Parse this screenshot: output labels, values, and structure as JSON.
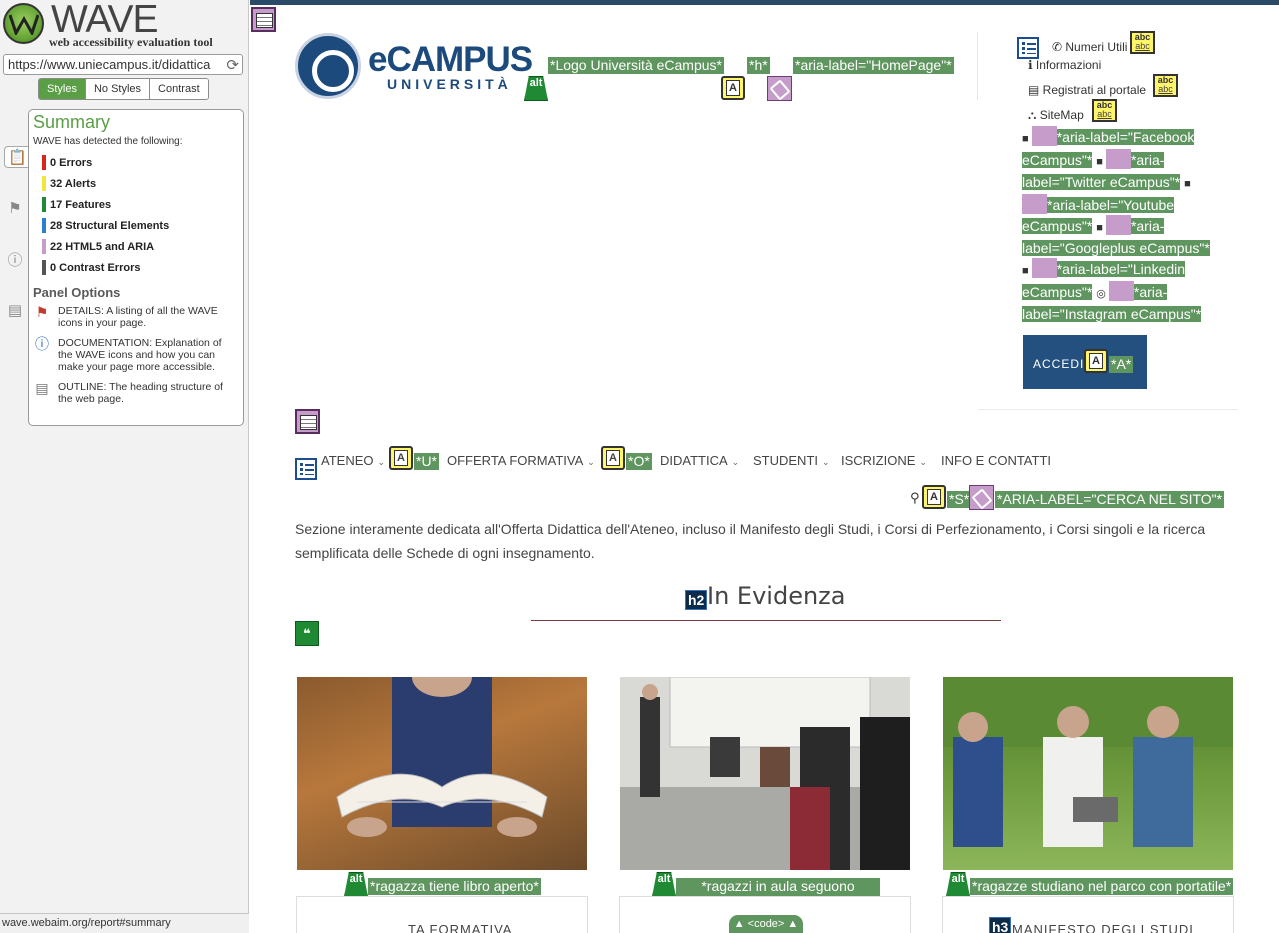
{
  "wave": {
    "logo_text": "WAVE",
    "subtitle": "web accessibility evaluation tool",
    "url": "https://www.uniecampus.it/didattica",
    "tabs": [
      "Styles",
      "No Styles",
      "Contrast"
    ],
    "summary_title": "Summary",
    "detected_text": "WAVE has detected the following:",
    "counts": [
      {
        "label": "0 Errors",
        "color": "#d9261c"
      },
      {
        "label": "32 Alerts",
        "color": "#f0e63c"
      },
      {
        "label": "17 Features",
        "color": "#1f8a33"
      },
      {
        "label": "28 Structural Elements",
        "color": "#2a7fd4"
      },
      {
        "label": "22 HTML5 and ARIA",
        "color": "#c69ccb"
      },
      {
        "label": "0 Contrast Errors",
        "color": "#555555"
      }
    ],
    "panel_options_title": "Panel Options",
    "options": [
      {
        "icon": "flag-icon",
        "text": "DETAILS: A listing of all the WAVE icons in your page."
      },
      {
        "icon": "info-icon",
        "text": "DOCUMENTATION: Explanation of the WAVE icons and how you can make your page more accessible."
      },
      {
        "icon": "outline-icon",
        "text": "OUTLINE: The heading structure of the web page."
      }
    ],
    "status_url": "wave.webaim.org/report#summary"
  },
  "page": {
    "logo_word": "eCAMPUS",
    "logo_sub": "UNIVERSITÀ",
    "labels": {
      "logo_alt": "*Logo Università eCampus*",
      "h_label": "*h*",
      "aria_home": "*aria-label=\"HomePage\"*",
      "u_label": "*U*",
      "o_label": "*O*",
      "s_label": "*S*",
      "search_aria": "*ARIA-LABEL=\"CERCA NEL SITO\"*",
      "a_label": "*A*"
    },
    "util_links": [
      {
        "icon": "phone-icon",
        "glyph": "📞",
        "text": "Numeri Utili"
      },
      {
        "icon": "info-icon",
        "glyph": "ℹ",
        "text": "Informazioni"
      },
      {
        "icon": "id-card-icon",
        "glyph": "▤",
        "text": "Registrati al portale"
      },
      {
        "icon": "sitemap-icon",
        "glyph": "⛬",
        "text": "SiteMap"
      }
    ],
    "social_labels": [
      "*aria-label=\"Facebook eCampus\"*",
      "*aria-label=\"Twitter eCampus\"*",
      "*aria-label=\"Youtube eCampus\"*",
      "*aria-label=\"Googleplus eCampus\"*",
      "*aria-label=\"Linkedin eCampus\"*",
      "*aria-label=\"Instagram eCampus\"*"
    ],
    "accedi": "ACCEDI",
    "nav": [
      "ATENEO",
      "OFFERTA FORMATIVA",
      "DIDATTICA",
      "STUDENTI",
      "ISCRIZIONE",
      "INFO E CONTATTI"
    ],
    "intro": "Sezione interamente dedicata all'Offerta Didattica dell'Ateneo, incluso il Manifesto degli Studi, i Corsi di Perfezionamento, i Corsi singoli e la ricerca semplificata delle Schede di ogni insegnamento.",
    "h2_tag": "h2",
    "h3_tag": "h3",
    "section_title": "In Evidenza",
    "cards": [
      {
        "alt": "*ragazza tiene libro aperto*",
        "title": "TA FORMATIVA"
      },
      {
        "alt": "*ragazzi in aula seguono lezione eCampus*",
        "title": ""
      },
      {
        "alt": "*ragazze studiano nel parco con portatile*",
        "title": "MANIFESTO DEGLI STUDI"
      }
    ],
    "code_tab": "▲ <code> ▲"
  }
}
